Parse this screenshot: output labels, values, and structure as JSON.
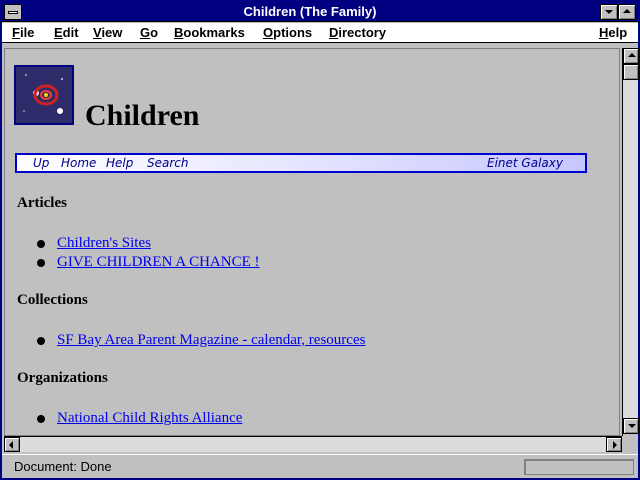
{
  "window": {
    "title": "Children (The Family)"
  },
  "menu": [
    {
      "label": "File",
      "accel": "F",
      "rest": "ile"
    },
    {
      "label": "Edit",
      "accel": "E",
      "rest": "dit"
    },
    {
      "label": "View",
      "accel": "V",
      "rest": "iew"
    },
    {
      "label": "Go",
      "accel": "G",
      "rest": "o"
    },
    {
      "label": "Bookmarks",
      "accel": "B",
      "rest": "ookmarks"
    },
    {
      "label": "Options",
      "accel": "O",
      "rest": "ptions"
    },
    {
      "label": "Directory",
      "accel": "D",
      "rest": "irectory"
    },
    {
      "label": "Help",
      "accel": "H",
      "rest": "elp"
    }
  ],
  "page": {
    "title": "Children",
    "nav": {
      "up": "Up",
      "home": "Home",
      "help": "Help",
      "search": "Search",
      "brand": "Einet Galaxy"
    },
    "sections": [
      {
        "heading": "Articles",
        "items": [
          "Children's Sites",
          "GIVE CHILDREN A CHANCE !"
        ]
      },
      {
        "heading": "Collections",
        "items": [
          "SF Bay Area Parent Magazine - calendar, resources"
        ]
      },
      {
        "heading": "Organizations",
        "items": [
          "National Child Rights Alliance"
        ]
      }
    ]
  },
  "status": {
    "text": "Document: Done"
  },
  "colors": {
    "titlebar": "#000080",
    "link": "#0000ee",
    "background": "#c0c0c0"
  }
}
